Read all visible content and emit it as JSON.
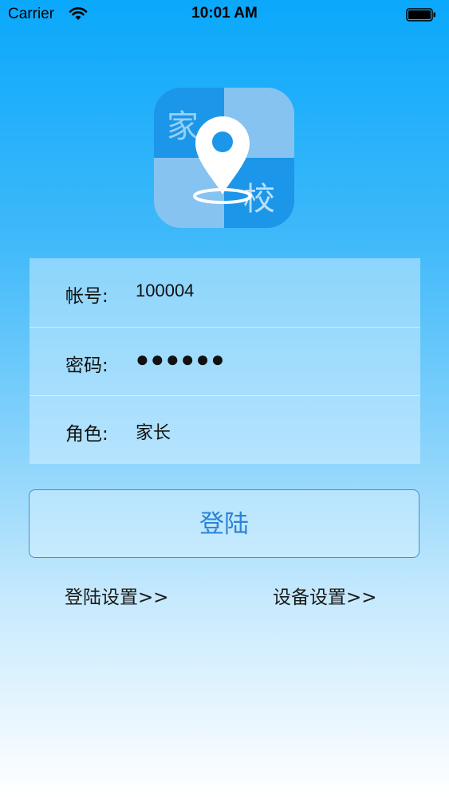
{
  "status_bar": {
    "carrier": "Carrier",
    "time": "10:01 AM",
    "icons": [
      "wifi-icon",
      "battery-icon"
    ]
  },
  "logo": {
    "char_top": "家",
    "char_bottom": "校",
    "colors": {
      "dark_blue": "#1c96e8",
      "light_blue": "#86c3f1",
      "pin": "#ffffff"
    },
    "icon": "map-pin-icon"
  },
  "form": {
    "account": {
      "label": "帐号:",
      "value": "100004"
    },
    "password": {
      "label": "密码:",
      "value": "●●●●●●"
    },
    "role": {
      "label": "角色:",
      "value": "家长"
    }
  },
  "login_button": {
    "label": "登陆",
    "color": "#2c83d6"
  },
  "links": {
    "login_settings": "登陆设置>>",
    "device_settings": "设备设置>>"
  },
  "background": {
    "top": "#0aa8fb",
    "bottom": "#ffffff"
  }
}
